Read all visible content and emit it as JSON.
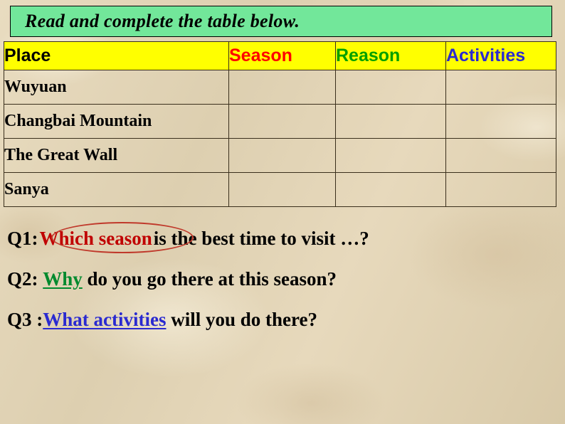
{
  "slide": {
    "banner_text": "Read and complete the table below.",
    "colors": {
      "banner_bg": "#72e79a",
      "header_bg": "#ffff00",
      "page_bg": "#e5d7ba",
      "season_header": "#ff0000",
      "reason_header": "#00a000",
      "activities_header": "#2a2ad0",
      "q1_highlight": "#c00000",
      "q2_highlight": "#008a2e",
      "q3_highlight": "#2a2ad0",
      "ellipse_stroke": "#c0392b"
    }
  },
  "table": {
    "headers": [
      "Place",
      "Season",
      "Reason",
      "Activities"
    ],
    "rows": [
      {
        "place": "Wuyuan",
        "season": "",
        "reason": "",
        "activities": ""
      },
      {
        "place": "Changbai Mountain",
        "season": "",
        "reason": "",
        "activities": ""
      },
      {
        "place": "The Great Wall",
        "season": "",
        "reason": "",
        "activities": ""
      },
      {
        "place": "Sanya",
        "season": "",
        "reason": "",
        "activities": ""
      }
    ]
  },
  "questions": [
    {
      "label": "Q1:",
      "highlight": "Which season",
      "rest": "is the best time to visit …?"
    },
    {
      "label": "Q2:",
      "highlight": "Why",
      "rest": "do you go there at this season?"
    },
    {
      "label": "Q3 :",
      "highlight": "What activities",
      "rest": "will you do there?"
    }
  ]
}
